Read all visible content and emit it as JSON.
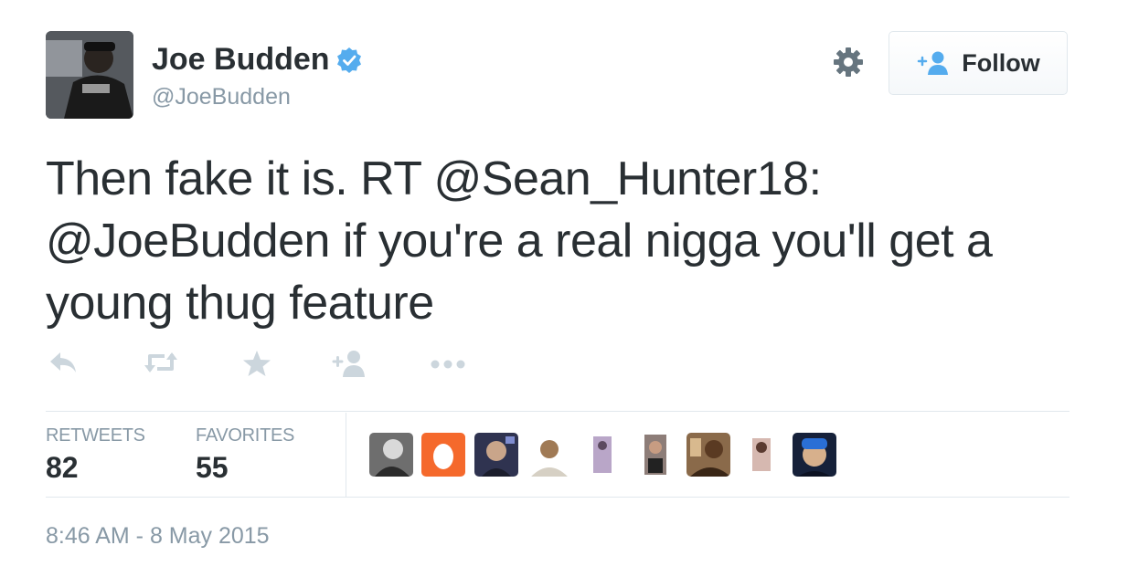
{
  "user": {
    "name": "Joe Budden",
    "handle": "@JoeBudden",
    "verified": true
  },
  "header": {
    "settings_icon": "gear-icon",
    "follow_label": "Follow"
  },
  "tweet": {
    "text_part1": "Then fake it is.  RT ",
    "mention1": "@Sean_Hunter18",
    "text_part2": ": ",
    "mention2": "@JoeBudden",
    "text_part3": " if you're a real nigga you'll get a young thug feature"
  },
  "actions": [
    "reply-icon",
    "retweet-icon",
    "favorite-icon",
    "follow-icon",
    "more-icon"
  ],
  "stats": {
    "retweets_label": "RETWEETS",
    "retweets_value": "82",
    "favorites_label": "FAVORITES",
    "favorites_value": "55"
  },
  "timestamp": "8:46 AM - 8 May 2015",
  "colors": {
    "text": "#292f33",
    "muted": "#8899a6",
    "verified": "#55acee",
    "egg": "#f5692c"
  }
}
